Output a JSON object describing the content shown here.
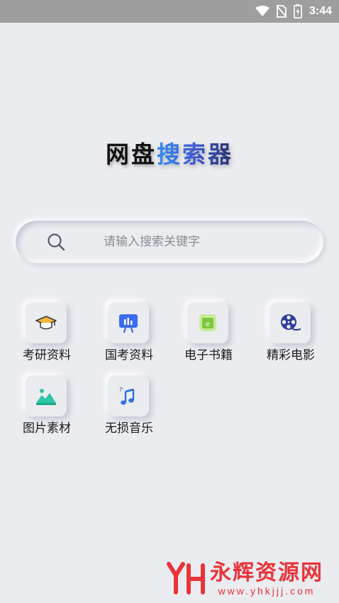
{
  "status_bar": {
    "time": "3:44",
    "icons": [
      "wifi-icon",
      "no-sim-icon",
      "battery-charging-icon"
    ]
  },
  "title": {
    "part1": "网盘",
    "part2": "搜索器"
  },
  "search": {
    "placeholder": "请输入搜索关键字",
    "value": "",
    "icon": "search-icon"
  },
  "categories": [
    {
      "label": "考研资料",
      "icon": "graduation-cap-icon"
    },
    {
      "label": "国考资料",
      "icon": "presentation-board-icon"
    },
    {
      "label": "电子书籍",
      "icon": "ebook-icon"
    },
    {
      "label": "精彩电影",
      "icon": "film-reel-icon"
    },
    {
      "label": "图片素材",
      "icon": "image-landscape-icon"
    },
    {
      "label": "无损音乐",
      "icon": "music-note-icon"
    }
  ],
  "watermark": {
    "name": "永辉资源网",
    "url": "www.yhkjjj.com",
    "color": "#e8343a"
  },
  "colors": {
    "background": "#ebecf0",
    "title_gradient_start": "#2e8ef0",
    "title_gradient_end": "#2a2f6e"
  }
}
